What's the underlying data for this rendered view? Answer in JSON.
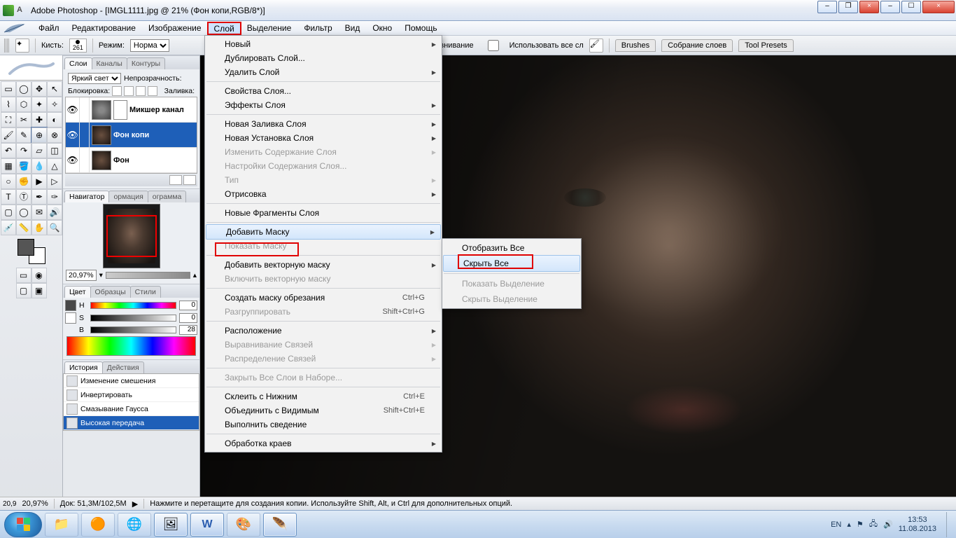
{
  "window": {
    "title": "Adobe Photoshop - [IMGL1111.jpg @ 21% (Фон копи,RGB/8*)]"
  },
  "menu": {
    "file": "Файл",
    "edit": "Редактирование",
    "image": "Изображение",
    "layer": "Слой",
    "select": "Выделение",
    "filter": "Фильтр",
    "view": "Вид",
    "window": "Окно",
    "help": "Помощь"
  },
  "options": {
    "brush_label": "Кисть:",
    "brush_size": "261",
    "mode_label": "Режим:",
    "mode_value": "Норма",
    "align_label": "Выравнивание",
    "use_all_label": "Использовать все сл",
    "tab_brushes": "Brushes",
    "tab_layers": "Собрание слоев",
    "tab_presets": "Tool Presets"
  },
  "layer_menu": {
    "new": "Новый",
    "duplicate": "Дублировать Слой...",
    "delete": "Удалить Слой",
    "properties": "Свойства Слоя...",
    "effects": "Эффекты Слоя",
    "new_fill": "Новая Заливка Слоя",
    "new_adjust": "Новая Установка Слоя",
    "change_content": "Изменить Содержание Слоя",
    "content_options": "Настройки Содержания Слоя...",
    "type": "Тип",
    "rasterize": "Отрисовка",
    "new_slices": "Новые Фрагменты Слоя",
    "add_mask": "Добавить Маску",
    "show_mask": "Показать Маску",
    "add_vector": "Добавить векторную маску",
    "enable_vector": "Включить векторную маску",
    "create_clip": "Создать маску обрезания",
    "clip_sc": "Ctrl+G",
    "ungroup": "Разгруппировать",
    "ungroup_sc": "Shift+Ctrl+G",
    "arrange": "Расположение",
    "align_linked": "Выравнивание Связей",
    "distribute_linked": "Распределение Связей",
    "lock_all": "Закрыть Все Слои в Наборе...",
    "merge_down": "Склеить с Нижним",
    "merge_down_sc": "Ctrl+E",
    "merge_visible": "Объединить с Видимым",
    "merge_visible_sc": "Shift+Ctrl+E",
    "flatten": "Выполнить сведение",
    "matting": "Обработка краев"
  },
  "mask_submenu": {
    "reveal_all": "Отобразить Все",
    "hide_all": "Скрыть Все",
    "reveal_sel": "Показать Выделение",
    "hide_sel": "Скрыть Выделение"
  },
  "panels": {
    "layers": {
      "tabs": {
        "layers": "Слои",
        "channels": "Каналы",
        "paths": "Контуры"
      },
      "blend": "Яркий свет",
      "opacity_label": "Непрозрачность:",
      "lock_label": "Блокировка:",
      "fill_label": "Заливка:",
      "layer1": "Микшер канал",
      "layer2": "Фон копи",
      "layer3": "Фон"
    },
    "navigator": {
      "tabs": {
        "navigator": "Навигатор",
        "info": "ормация",
        "histogram": "ограмма"
      },
      "zoom": "20,97%"
    },
    "color": {
      "tabs": {
        "color": "Цвет",
        "swatches": "Образцы",
        "styles": "Стили"
      },
      "h": "H",
      "h_val": "0",
      "s": "S",
      "s_val": "0",
      "b": "B",
      "b_val": "28"
    },
    "history": {
      "tabs": {
        "history": "История",
        "actions": "Действия"
      },
      "items": [
        "Изменение смешения",
        "Инвертировать",
        "Смазывание Гаусса",
        "Высокая передача"
      ]
    }
  },
  "status": {
    "zoom_tiny": "20,9",
    "zoom": "20,97%",
    "doc": "Док: 51,3M/102,5M",
    "hint": "Нажмите и перетащите для создания копии.  Используйте Shift, Alt, и Ctrl для дополнительных опций."
  },
  "taskbar": {
    "lang": "EN",
    "time": "13:53",
    "date": "11.08.2013"
  }
}
